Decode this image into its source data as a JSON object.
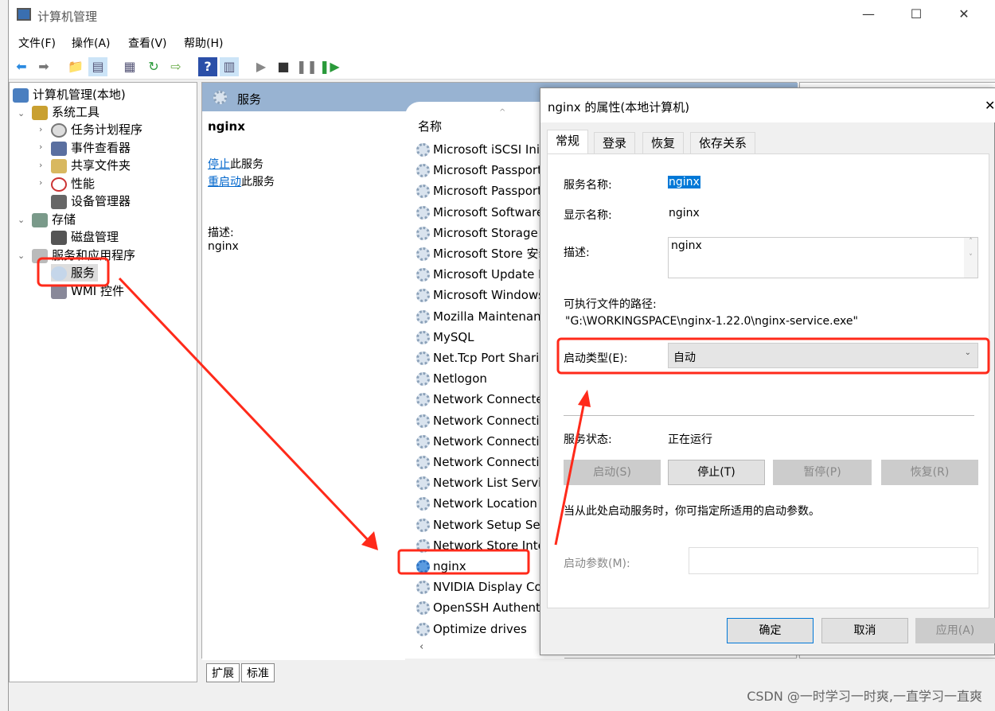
{
  "window": {
    "title": "计算机管理",
    "controls": [
      "—",
      "☐",
      "✕"
    ]
  },
  "menu": [
    "文件(F)",
    "操作(A)",
    "查看(V)",
    "帮助(H)"
  ],
  "toolbar": [
    "back-icon",
    "forward-icon",
    "up-folder-icon",
    "show-hide-tree-icon",
    "properties-icon",
    "refresh-icon",
    "export-icon",
    "help-icon",
    "show-hide-action-icon",
    "play-icon",
    "stop-icon",
    "pause-icon",
    "resume-icon"
  ],
  "tree": {
    "root": "计算机管理(本地)",
    "items": [
      {
        "label": "系统工具",
        "level": 1,
        "expanded": true
      },
      {
        "label": "任务计划程序",
        "level": 2,
        "collapsed": true
      },
      {
        "label": "事件查看器",
        "level": 2,
        "collapsed": true
      },
      {
        "label": "共享文件夹",
        "level": 2,
        "collapsed": true
      },
      {
        "label": "性能",
        "level": 2,
        "collapsed": true
      },
      {
        "label": "设备管理器",
        "level": 2
      },
      {
        "label": "存储",
        "level": 1,
        "expanded": true
      },
      {
        "label": "磁盘管理",
        "level": 2
      },
      {
        "label": "服务和应用程序",
        "level": 1,
        "expanded": true
      },
      {
        "label": "服务",
        "level": 2,
        "selected": true
      },
      {
        "label": "WMI 控件",
        "level": 2
      }
    ]
  },
  "services_panel": {
    "header": "服务",
    "selected_name": "nginx",
    "stop_link": "停止",
    "stop_suffix": "此服务",
    "restart_link": "重启动",
    "restart_suffix": "此服务",
    "desc_label": "描述:",
    "desc_value": "nginx",
    "column_name": "名称",
    "rows": [
      "Microsoft iSCSI Initi",
      "Microsoft Passport",
      "Microsoft Passport C",
      "Microsoft Software",
      "Microsoft Storage S",
      "Microsoft Store 安装",
      "Microsoft Update H",
      "Microsoft Windows",
      "Mozilla Maintenanc",
      "MySQL",
      "Net.Tcp Port Sharin",
      "Netlogon",
      "Network Connected",
      "Network Connectio",
      "Network Connectio",
      "Network Connectiv",
      "Network List Servic",
      "Network Location A",
      "Network Setup Serv",
      "Network Store Inter",
      "nginx",
      "NVIDIA Display Cor",
      "OpenSSH Authenti",
      "Optimize drives"
    ],
    "selected_index": 20
  },
  "bottom_tabs": [
    "扩展",
    "标准"
  ],
  "dialog": {
    "title": "nginx 的属性(本地计算机)",
    "close": "✕",
    "tabs": [
      "常规",
      "登录",
      "恢复",
      "依存关系"
    ],
    "active_tab": 0,
    "service_name_label": "服务名称:",
    "service_name": "nginx",
    "display_name_label": "显示名称:",
    "display_name": "nginx",
    "description_label": "描述:",
    "description": "nginx",
    "path_label": "可执行文件的路径:",
    "path": "\"G:\\WORKINGSPACE\\nginx-1.22.0\\nginx-service.exe\"",
    "startup_label": "启动类型(E):",
    "startup_value": "自动",
    "status_label": "服务状态:",
    "status_value": "正在运行",
    "buttons": {
      "start": "启动(S)",
      "stop": "停止(T)",
      "pause": "暂停(P)",
      "resume": "恢复(R)"
    },
    "hint": "当从此处启动服务时，你可指定所适用的启动参数。",
    "params_label": "启动参数(M):",
    "params_value": "",
    "ok": "确定",
    "cancel": "取消",
    "apply": "应用(A)"
  },
  "annotation_color": "#ff2a1a",
  "watermark": "CSDN @一时学习一时爽,一直学习一直爽"
}
